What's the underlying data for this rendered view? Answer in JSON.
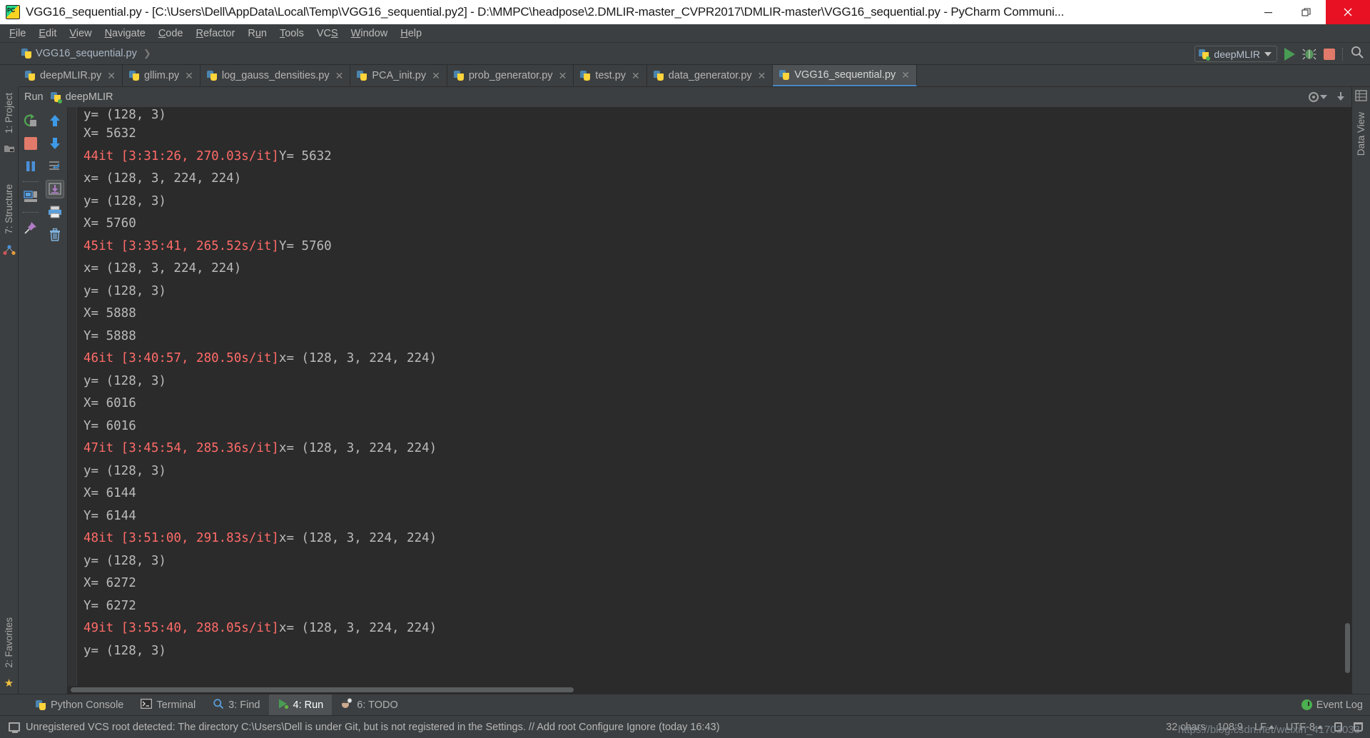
{
  "window": {
    "title": "VGG16_sequential.py - [C:\\Users\\Dell\\AppData\\Local\\Temp\\VGG16_sequential.py2] - D:\\MMPC\\headpose\\2.DMLIR-master_CVPR2017\\DMLIR-master\\VGG16_sequential.py - PyCharm Communi...",
    "minimize": "—",
    "restore": "❐",
    "close": "✕"
  },
  "menubar": [
    {
      "label": "File",
      "mnemonic": "F"
    },
    {
      "label": "Edit",
      "mnemonic": "E"
    },
    {
      "label": "View",
      "mnemonic": "V"
    },
    {
      "label": "Navigate",
      "mnemonic": "N"
    },
    {
      "label": "Code",
      "mnemonic": "C"
    },
    {
      "label": "Refactor",
      "mnemonic": "R"
    },
    {
      "label": "Run",
      "mnemonic": "n"
    },
    {
      "label": "Tools",
      "mnemonic": "T"
    },
    {
      "label": "VCS",
      "mnemonic": "S"
    },
    {
      "label": "Window",
      "mnemonic": "W"
    },
    {
      "label": "Help",
      "mnemonic": "H"
    }
  ],
  "navbar": {
    "breadcrumb": "VGG16_sequential.py",
    "run_configuration": "deepMLIR",
    "icons": [
      "run-icon",
      "debug-icon",
      "stop-icon",
      "search-everywhere-icon"
    ]
  },
  "tabs": [
    {
      "label": "deepMLIR.py",
      "active": false
    },
    {
      "label": "gllim.py",
      "active": false
    },
    {
      "label": "log_gauss_densities.py",
      "active": false
    },
    {
      "label": "PCA_init.py",
      "active": false
    },
    {
      "label": "prob_generator.py",
      "active": false
    },
    {
      "label": "test.py",
      "active": false
    },
    {
      "label": "data_generator.py",
      "active": false
    },
    {
      "label": "VGG16_sequential.py",
      "active": true
    }
  ],
  "left_rail": {
    "top": [
      "1: Project"
    ],
    "middle": [
      "7: Structure"
    ],
    "bottom": [
      "2: Favorites"
    ]
  },
  "right_rail": [
    "Data View"
  ],
  "run_window": {
    "title": "Run",
    "config_name": "deepMLIR",
    "toolbar_left": [
      "rerun-icon",
      "stop-icon",
      "pause-icon",
      "restore-layout-icon",
      "pin-icon"
    ],
    "toolbar_right": [
      "up-arrow-icon",
      "down-arrow-icon",
      "soft-wrap-icon",
      "scroll-to-end-icon",
      "print-icon",
      "trash-icon"
    ],
    "header_right": [
      "settings-gear-icon",
      "hide-icon"
    ]
  },
  "console": {
    "lines": [
      {
        "text": "y= (128, 3)",
        "type": "plain",
        "clipped": true
      },
      {
        "text": "X= 5632",
        "type": "plain"
      },
      {
        "red": "44it [3:31:26, 270.03s/it]",
        "rest": "Y= 5632",
        "type": "progress"
      },
      {
        "text": "x= (128, 3, 224, 224)",
        "type": "plain"
      },
      {
        "text": "y= (128, 3)",
        "type": "plain"
      },
      {
        "text": "X= 5760",
        "type": "plain"
      },
      {
        "red": "45it [3:35:41, 265.52s/it]",
        "rest": "Y= 5760",
        "type": "progress"
      },
      {
        "text": "x= (128, 3, 224, 224)",
        "type": "plain"
      },
      {
        "text": "y= (128, 3)",
        "type": "plain"
      },
      {
        "text": "X= 5888",
        "type": "plain"
      },
      {
        "text": "Y= 5888",
        "type": "plain"
      },
      {
        "red": "46it [3:40:57, 280.50s/it]",
        "rest": "x= (128, 3, 224, 224)",
        "type": "progress"
      },
      {
        "text": "y= (128, 3)",
        "type": "plain"
      },
      {
        "text": "X= 6016",
        "type": "plain"
      },
      {
        "text": "Y= 6016",
        "type": "plain"
      },
      {
        "red": "47it [3:45:54, 285.36s/it]",
        "rest": "x= (128, 3, 224, 224)",
        "type": "progress"
      },
      {
        "text": "y= (128, 3)",
        "type": "plain"
      },
      {
        "text": "X= 6144",
        "type": "plain"
      },
      {
        "text": "Y= 6144",
        "type": "plain"
      },
      {
        "red": "48it [3:51:00, 291.83s/it]",
        "rest": "x= (128, 3, 224, 224)",
        "type": "progress"
      },
      {
        "text": "y= (128, 3)",
        "type": "plain"
      },
      {
        "text": "X= 6272",
        "type": "plain"
      },
      {
        "text": "Y= 6272",
        "type": "plain"
      },
      {
        "red": "49it [3:55:40, 288.05s/it]",
        "rest": "x= (128, 3, 224, 224)",
        "type": "progress"
      },
      {
        "text": "y= (128, 3)",
        "type": "plain"
      }
    ],
    "colors": {
      "red": "#ff6b68",
      "plain": "#bbbbbb",
      "background": "#2b2b2b"
    }
  },
  "bottom_toolwindows": [
    {
      "label": "Python Console",
      "num": "",
      "active": false,
      "icon": "python-console-icon"
    },
    {
      "label": "Terminal",
      "num": "",
      "active": false,
      "icon": "terminal-icon"
    },
    {
      "label": "3: Find",
      "num": "3",
      "active": false,
      "icon": "find-icon"
    },
    {
      "label": "4: Run",
      "num": "4",
      "active": true,
      "icon": "run-icon"
    },
    {
      "label": "6: TODO",
      "num": "6",
      "active": false,
      "icon": "todo-icon"
    }
  ],
  "event_log": "Event Log",
  "statusbar": {
    "message": "Unregistered VCS root detected: The directory C:\\Users\\Dell is under Git, but is not registered in the Settings. // Add root  Configure  Ignore (today 16:43)",
    "chars": "32 chars",
    "caret": "108:9",
    "line_sep": "LF",
    "encoding": "UTF-8",
    "indent": "",
    "watermark": "https://blog.csdn.net/weixin_41703033"
  }
}
